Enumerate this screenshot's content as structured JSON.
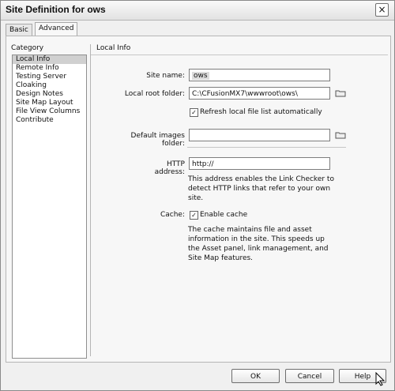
{
  "window": {
    "title": "Site Definition for ows",
    "close": "×"
  },
  "tabs": [
    {
      "label": "Basic"
    },
    {
      "label": "Advanced"
    }
  ],
  "category": {
    "heading": "Category",
    "items": [
      "Local Info",
      "Remote Info",
      "Testing Server",
      "Cloaking",
      "Design Notes",
      "Site Map Layout",
      "File View Columns",
      "Contribute"
    ]
  },
  "section": {
    "title": "Local Info"
  },
  "fields": {
    "site_name_label": "Site name:",
    "site_name_value": "ows",
    "local_root_label": "Local root folder:",
    "local_root_value": "C:\\CFusionMX7\\wwwroot\\ows\\",
    "refresh_label": "Refresh local file list automatically",
    "default_images_label": "Default images folder:",
    "default_images_value": "",
    "http_label": "HTTP address:",
    "http_value": "http://",
    "http_note": "This address enables the Link Checker to detect HTTP links that refer to your own site.",
    "cache_label": "Cache:",
    "enable_cache_label": "Enable cache",
    "cache_note": "The cache maintains file and asset information in the site.  This speeds up the Asset panel, link management, and Site Map features."
  },
  "buttons": {
    "ok": "OK",
    "cancel": "Cancel",
    "help": "Help"
  },
  "icons": {
    "folder": "folder-icon",
    "check": "✓",
    "cursor": "mouse-cursor-icon"
  }
}
